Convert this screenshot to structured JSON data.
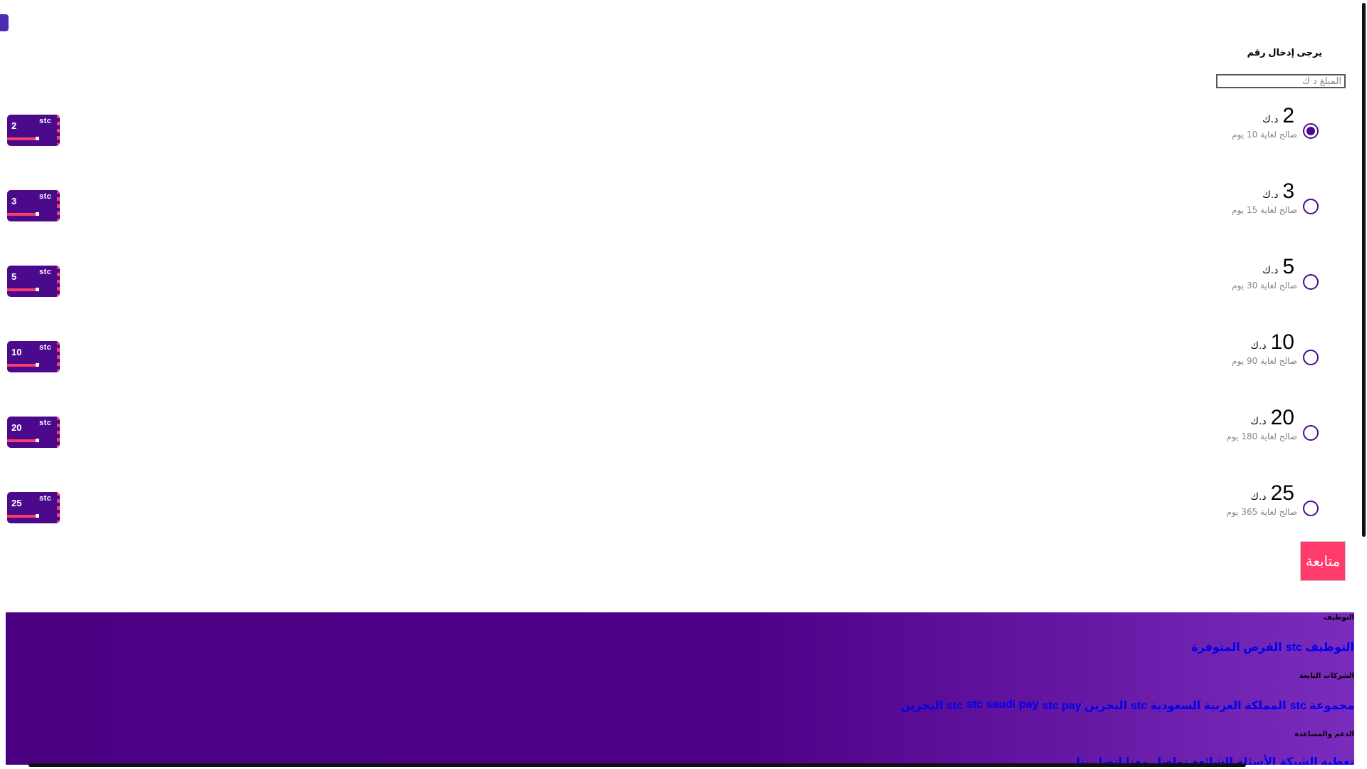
{
  "form": {
    "prompt": "يرجى إدخال رقم",
    "amount_placeholder": "المبلغ د ك"
  },
  "options": [
    {
      "amount": "2",
      "currency": "د.ك",
      "validity": "صالح لغاية 10 يوم",
      "selected": true,
      "card_amount": "2"
    },
    {
      "amount": "3",
      "currency": "د.ك",
      "validity": "صالح لغاية 15 يوم",
      "selected": false,
      "card_amount": "3"
    },
    {
      "amount": "5",
      "currency": "د.ك",
      "validity": "صالح لغاية 30 يوم",
      "selected": false,
      "card_amount": "5"
    },
    {
      "amount": "10",
      "currency": "د.ك",
      "validity": "صالح لغاية 90 يوم",
      "selected": false,
      "card_amount": "10"
    },
    {
      "amount": "20",
      "currency": "د.ك",
      "validity": "صالح لغاية 180 يوم",
      "selected": false,
      "card_amount": "20"
    },
    {
      "amount": "25",
      "currency": "د.ك",
      "validity": "صالح لغاية 365 يوم",
      "selected": false,
      "card_amount": "25"
    }
  ],
  "card": {
    "logo": "stc"
  },
  "continue_label": "متابعة",
  "footer": {
    "careers_title": "التوظيف",
    "careers_links": [
      "التوظيف stc",
      "القرص المتوفرة"
    ],
    "companies_title": "الشركات التابعة",
    "companies_links": [
      "مجموعة stc",
      "المملكة العربية السعودية stc",
      "البحرين stc pay",
      "stc saudi pay",
      "stc البحرين"
    ],
    "support_title": "الدعم والمساعدة",
    "support_links": [
      "تغطية الشبكة",
      "الأسئلة الشائعة",
      "تواصل معنا",
      "اتصل بنا"
    ]
  },
  "colors": {
    "brand_purple": "#4b0a8c",
    "accent_pink": "#ff3b6b",
    "link_blue": "#0000ee"
  }
}
